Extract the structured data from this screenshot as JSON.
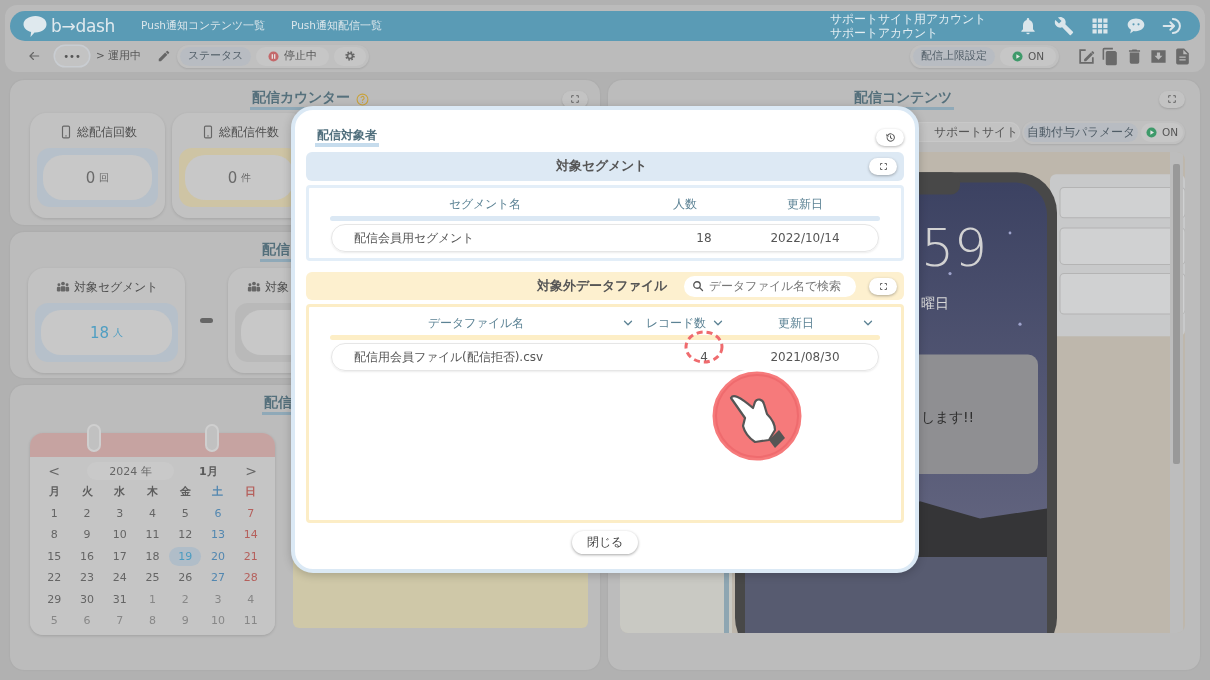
{
  "header": {
    "logo": "b→dash",
    "nav": [
      {
        "label": "Push通知コンテンツ一覧"
      },
      {
        "label": "Push通知配信一覧"
      }
    ],
    "account": {
      "site": "サポートサイト用アカウント",
      "user": "サポートアカウント"
    }
  },
  "toolbar": {
    "more": "•••",
    "breadcrumb": "> 運用中",
    "status_label": "ステータス",
    "status_value": "停止中",
    "limit_label": "配信上限設定",
    "limit_toggle": {
      "label": "ON",
      "on": true
    }
  },
  "counter_panel": {
    "title": "配信カウンター",
    "cards": [
      {
        "label": "総配信回数",
        "value": "0",
        "unit": "回",
        "highlighted": false,
        "color": "#b6c0ca"
      },
      {
        "label": "総配信件数",
        "value": "0",
        "unit": "件",
        "highlighted": false,
        "color": "#cec4a4"
      }
    ]
  },
  "target_panel": {
    "title": "配信",
    "cards": [
      {
        "label": "対象セグメント",
        "value": "18",
        "unit": "人",
        "highlighted": true,
        "color": "#b6c0ca"
      },
      {
        "label": "対象",
        "color": "#b9b9b9"
      }
    ]
  },
  "schedule_panel": {
    "title": "配信",
    "calendar": {
      "prev": "<",
      "year": "2024 年",
      "month": "1月",
      "next": ">",
      "weekdays": [
        {
          "text": "月",
          "kind": "weekday"
        },
        {
          "text": "火",
          "kind": "weekday"
        },
        {
          "text": "水",
          "kind": "weekday"
        },
        {
          "text": "木",
          "kind": "weekday"
        },
        {
          "text": "金",
          "kind": "weekday"
        },
        {
          "text": "土",
          "kind": "sat"
        },
        {
          "text": "日",
          "kind": "sun"
        }
      ],
      "weeks": [
        [
          {
            "text": "1",
            "kind": "weekday",
            "selected": false
          },
          {
            "text": "2",
            "kind": "weekday",
            "selected": false
          },
          {
            "text": "3",
            "kind": "weekday",
            "selected": false
          },
          {
            "text": "4",
            "kind": "weekday",
            "selected": false
          },
          {
            "text": "5",
            "kind": "weekday",
            "selected": false
          },
          {
            "text": "6",
            "kind": "sat",
            "selected": false
          },
          {
            "text": "7",
            "kind": "sun",
            "selected": false
          }
        ],
        [
          {
            "text": "8",
            "kind": "weekday",
            "selected": false
          },
          {
            "text": "9",
            "kind": "weekday",
            "selected": false
          },
          {
            "text": "10",
            "kind": "weekday",
            "selected": false
          },
          {
            "text": "11",
            "kind": "weekday",
            "selected": false
          },
          {
            "text": "12",
            "kind": "weekday",
            "selected": false
          },
          {
            "text": "13",
            "kind": "sat",
            "selected": false
          },
          {
            "text": "14",
            "kind": "sun",
            "selected": false
          }
        ],
        [
          {
            "text": "15",
            "kind": "weekday",
            "selected": false
          },
          {
            "text": "16",
            "kind": "weekday",
            "selected": false
          },
          {
            "text": "17",
            "kind": "weekday",
            "selected": false
          },
          {
            "text": "18",
            "kind": "weekday",
            "selected": false
          },
          {
            "text": "19",
            "kind": "weekday",
            "selected": true
          },
          {
            "text": "20",
            "kind": "sat",
            "selected": false
          },
          {
            "text": "21",
            "kind": "sun",
            "selected": false
          }
        ],
        [
          {
            "text": "22",
            "kind": "weekday",
            "selected": false
          },
          {
            "text": "23",
            "kind": "weekday",
            "selected": false
          },
          {
            "text": "24",
            "kind": "weekday",
            "selected": false
          },
          {
            "text": "25",
            "kind": "weekday",
            "selected": false
          },
          {
            "text": "26",
            "kind": "weekday",
            "selected": false
          },
          {
            "text": "27",
            "kind": "sat",
            "selected": false
          },
          {
            "text": "28",
            "kind": "sun",
            "selected": false
          }
        ],
        [
          {
            "text": "29",
            "kind": "weekday",
            "selected": false
          },
          {
            "text": "30",
            "kind": "weekday",
            "selected": false
          },
          {
            "text": "31",
            "kind": "weekday",
            "selected": false
          },
          {
            "text": "1",
            "kind": "other",
            "selected": false
          },
          {
            "text": "2",
            "kind": "other",
            "selected": false
          },
          {
            "text": "3",
            "kind": "other",
            "selected": false
          },
          {
            "text": "4",
            "kind": "other",
            "selected": false
          }
        ],
        [
          {
            "text": "5",
            "kind": "other",
            "selected": false
          },
          {
            "text": "6",
            "kind": "other",
            "selected": false
          },
          {
            "text": "7",
            "kind": "other",
            "selected": false
          },
          {
            "text": "8",
            "kind": "other",
            "selected": false
          },
          {
            "text": "9",
            "kind": "other",
            "selected": false
          },
          {
            "text": "10",
            "kind": "other",
            "selected": false
          },
          {
            "text": "11",
            "kind": "other",
            "selected": false
          }
        ]
      ]
    }
  },
  "contents_panel": {
    "title": "配信コンテンツ",
    "site_field": "サポートサイト",
    "param_button": "自動付与パラメータ",
    "param_toggle": {
      "label": "ON",
      "on": true
    },
    "preview": {
      "kind": "picture",
      "clock": "59",
      "date": "曜日",
      "message": "します!!"
    }
  },
  "modal": {
    "title": "配信対象者",
    "segments": {
      "title": "対象セグメント",
      "columns": [
        {
          "label": "セグメント名",
          "sortable": false
        },
        {
          "label": "人数",
          "sortable": false
        },
        {
          "label": "更新日",
          "sortable": false
        }
      ],
      "rows": [
        [
          "配信会員用セグメント",
          "18",
          "2022/10/14"
        ]
      ]
    },
    "excluded_files": {
      "title": "対象外データファイル",
      "placeholder": "データファイル名で検索",
      "columns": [
        {
          "label": "データファイル名",
          "sortable": true
        },
        {
          "label": "レコード数",
          "sortable": true
        },
        {
          "label": "更新日",
          "sortable": true
        }
      ],
      "rows": [
        [
          "配信用会員ファイル(配信拒否).csv",
          "4",
          "2021/08/30"
        ]
      ]
    },
    "close": "閉じる"
  }
}
